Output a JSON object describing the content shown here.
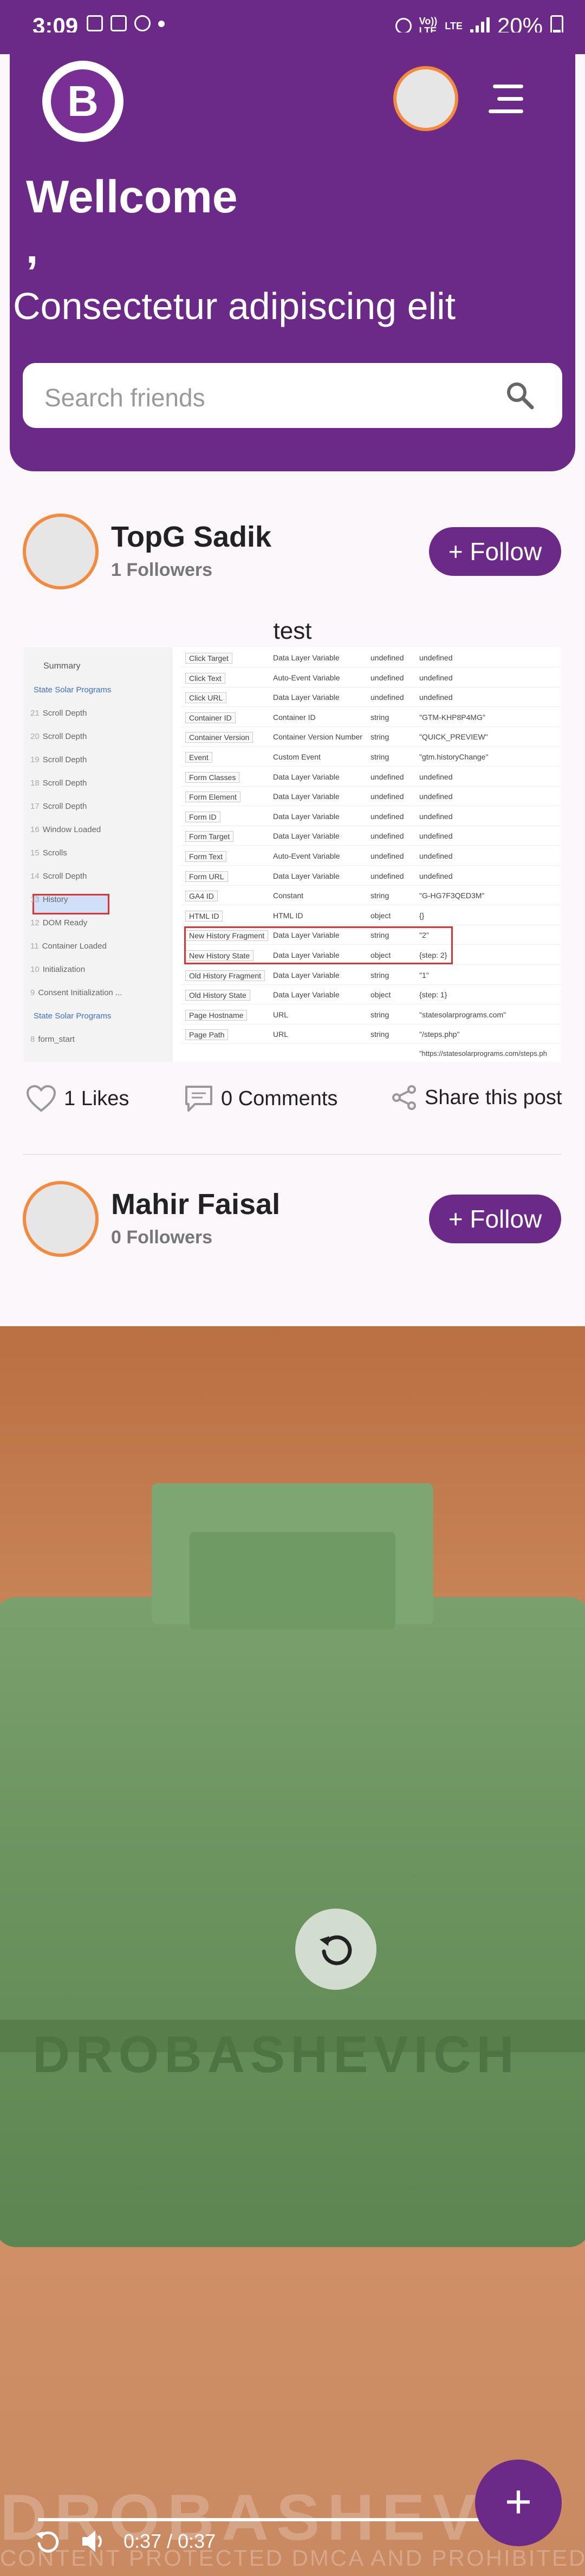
{
  "status_bar": {
    "time": "3:09",
    "network_top": "Vo))",
    "network_bottom": "LTE",
    "network2_top": "LTE",
    "network2_bottom": "",
    "battery": "20%"
  },
  "header": {
    "logo_letter": "B",
    "welcome": "Wellcome",
    "comma": ",",
    "subtitle": "Consectetur adipiscing elit",
    "search_placeholder": "Search friends"
  },
  "posts": [
    {
      "author": "TopG Sadik",
      "followers": "1 Followers",
      "follow_label": "Follow",
      "title": "test",
      "likes": "1 Likes",
      "comments": "0 Comments",
      "share": "Share this post"
    },
    {
      "author": "Mahir Faisal",
      "followers": "0 Followers",
      "follow_label": "Follow"
    }
  ],
  "gtm": {
    "summary": "Summary",
    "sidebar": [
      {
        "num": "",
        "label": "State Solar Programs"
      },
      {
        "num": "21",
        "label": "Scroll Depth"
      },
      {
        "num": "20",
        "label": "Scroll Depth"
      },
      {
        "num": "19",
        "label": "Scroll Depth"
      },
      {
        "num": "18",
        "label": "Scroll Depth"
      },
      {
        "num": "17",
        "label": "Scroll Depth"
      },
      {
        "num": "16",
        "label": "Window Loaded"
      },
      {
        "num": "15",
        "label": "Scrolls"
      },
      {
        "num": "14",
        "label": "Scroll Depth"
      },
      {
        "num": "13",
        "label": "History"
      },
      {
        "num": "12",
        "label": "DOM Ready"
      },
      {
        "num": "11",
        "label": "Container Loaded"
      },
      {
        "num": "10",
        "label": "Initialization"
      },
      {
        "num": "9",
        "label": "Consent Initialization ..."
      },
      {
        "num": "",
        "label": "State Solar Programs"
      },
      {
        "num": "8",
        "label": "form_start"
      }
    ],
    "rows": [
      [
        "Click Target",
        "Data Layer Variable",
        "undefined",
        "undefined"
      ],
      [
        "Click Text",
        "Auto-Event Variable",
        "undefined",
        "undefined"
      ],
      [
        "Click URL",
        "Data Layer Variable",
        "undefined",
        "undefined"
      ],
      [
        "Container ID",
        "Container ID",
        "string",
        "\"GTM-KHP8P4MG\""
      ],
      [
        "Container Version",
        "Container Version Number",
        "string",
        "\"QUICK_PREVIEW\""
      ],
      [
        "Event",
        "Custom Event",
        "string",
        "\"gtm.historyChange\""
      ],
      [
        "Form Classes",
        "Data Layer Variable",
        "undefined",
        "undefined"
      ],
      [
        "Form Element",
        "Data Layer Variable",
        "undefined",
        "undefined"
      ],
      [
        "Form ID",
        "Data Layer Variable",
        "undefined",
        "undefined"
      ],
      [
        "Form Target",
        "Data Layer Variable",
        "undefined",
        "undefined"
      ],
      [
        "Form Text",
        "Auto-Event Variable",
        "undefined",
        "undefined"
      ],
      [
        "Form URL",
        "Data Layer Variable",
        "undefined",
        "undefined"
      ],
      [
        "GA4 ID",
        "Constant",
        "string",
        "\"G-HG7F3QED3M\""
      ],
      [
        "HTML ID",
        "HTML ID",
        "object",
        "{}"
      ],
      [
        "New History Fragment",
        "Data Layer Variable",
        "string",
        "\"2\""
      ],
      [
        "New History State",
        "Data Layer Variable",
        "object",
        "{step: 2}"
      ],
      [
        "Old History Fragment",
        "Data Layer Variable",
        "string",
        "\"1\""
      ],
      [
        "Old History State",
        "Data Layer Variable",
        "object",
        "{step: 1}"
      ],
      [
        "Page Hostname",
        "URL",
        "string",
        "\"statesolarprograms.com\""
      ],
      [
        "Page Path",
        "URL",
        "string",
        "\"/steps.php\""
      ]
    ],
    "page_url": "\"https://statesolarprograms.com/steps.ph"
  },
  "video": {
    "brand_text": "DROBASHEVICH",
    "watermark": "DROBASHEV",
    "watermark_small": "CONTENT PROTECTED DMCA AND PROHIBITED COPY",
    "time": "0:37 / 0:37",
    "progress": 1.0
  },
  "fab_label": "+",
  "colors": {
    "primary": "#6b2a87",
    "accent": "#f58a3c"
  }
}
